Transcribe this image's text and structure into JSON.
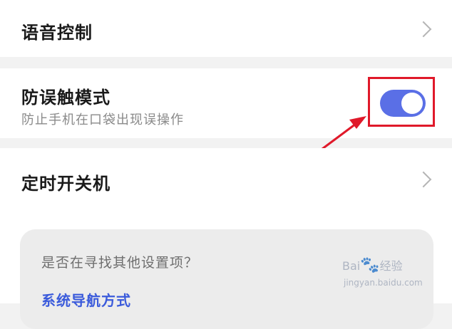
{
  "settings": {
    "voice_control": {
      "title": "语音控制"
    },
    "anti_mistouch": {
      "title": "防误触模式",
      "subtitle": "防止手机在口袋出现误操作",
      "enabled": true
    },
    "scheduled_power": {
      "title": "定时开关机"
    }
  },
  "help": {
    "question": "是否在寻找其他设置项？",
    "link": "系统导航方式"
  },
  "watermark": {
    "brand": "Bai",
    "paw": "🐾",
    "brand_suffix": "经验",
    "url": "jingyan.baidu.com"
  },
  "colors": {
    "toggle_on": "#5a6fe6",
    "highlight": "#e0192a",
    "link": "#3b5bdb"
  }
}
